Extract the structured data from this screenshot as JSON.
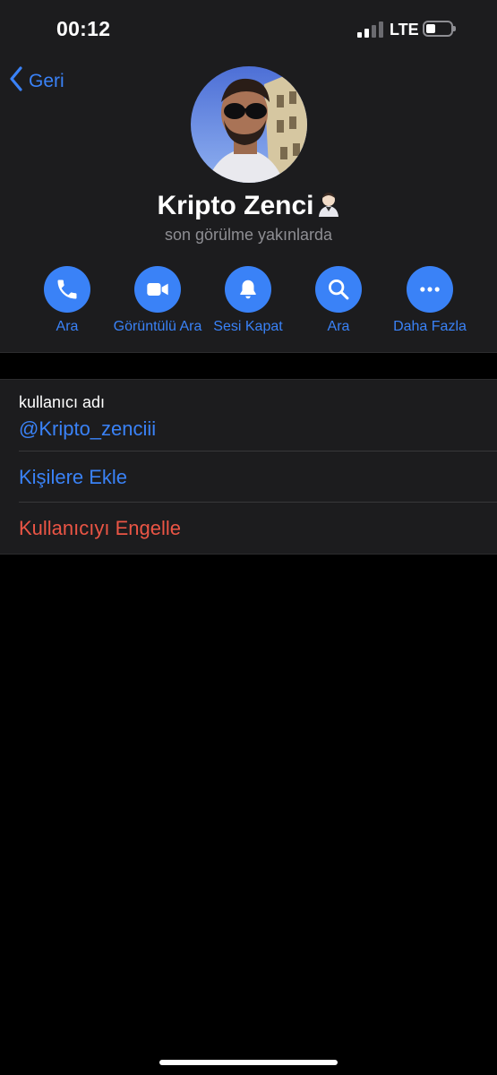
{
  "status_bar": {
    "time": "00:12",
    "network": "LTE",
    "icons": {
      "signal": "signal-bars-icon",
      "battery": "battery-low-icon"
    }
  },
  "nav": {
    "back_label": "Geri",
    "back_icon": "chevron-left-icon"
  },
  "profile": {
    "name": "Kripto Zenci",
    "name_emoji_icon": "person-emoji-icon",
    "status": "son görülme yakınlarda",
    "avatar_icon": "profile-photo"
  },
  "actions": [
    {
      "label": "Ara",
      "icon": "phone-icon"
    },
    {
      "label": "Görüntülü Ara",
      "icon": "video-camera-icon"
    },
    {
      "label": "Sesi Kapat",
      "icon": "bell-icon"
    },
    {
      "label": "Ara",
      "icon": "search-icon"
    },
    {
      "label": "Daha Fazla",
      "icon": "more-dots-icon"
    }
  ],
  "info": {
    "username_label": "kullanıcı adı",
    "username_value": "@Kripto_zenciii",
    "add_contact": "Kişilere Ekle",
    "block_user": "Kullanıcıyı Engelle"
  },
  "colors": {
    "accent": "#3a82f7",
    "destructive": "#eb5545",
    "secondary_text": "#8e8e93",
    "panel_bg": "#1c1c1e",
    "page_bg": "#000000"
  }
}
